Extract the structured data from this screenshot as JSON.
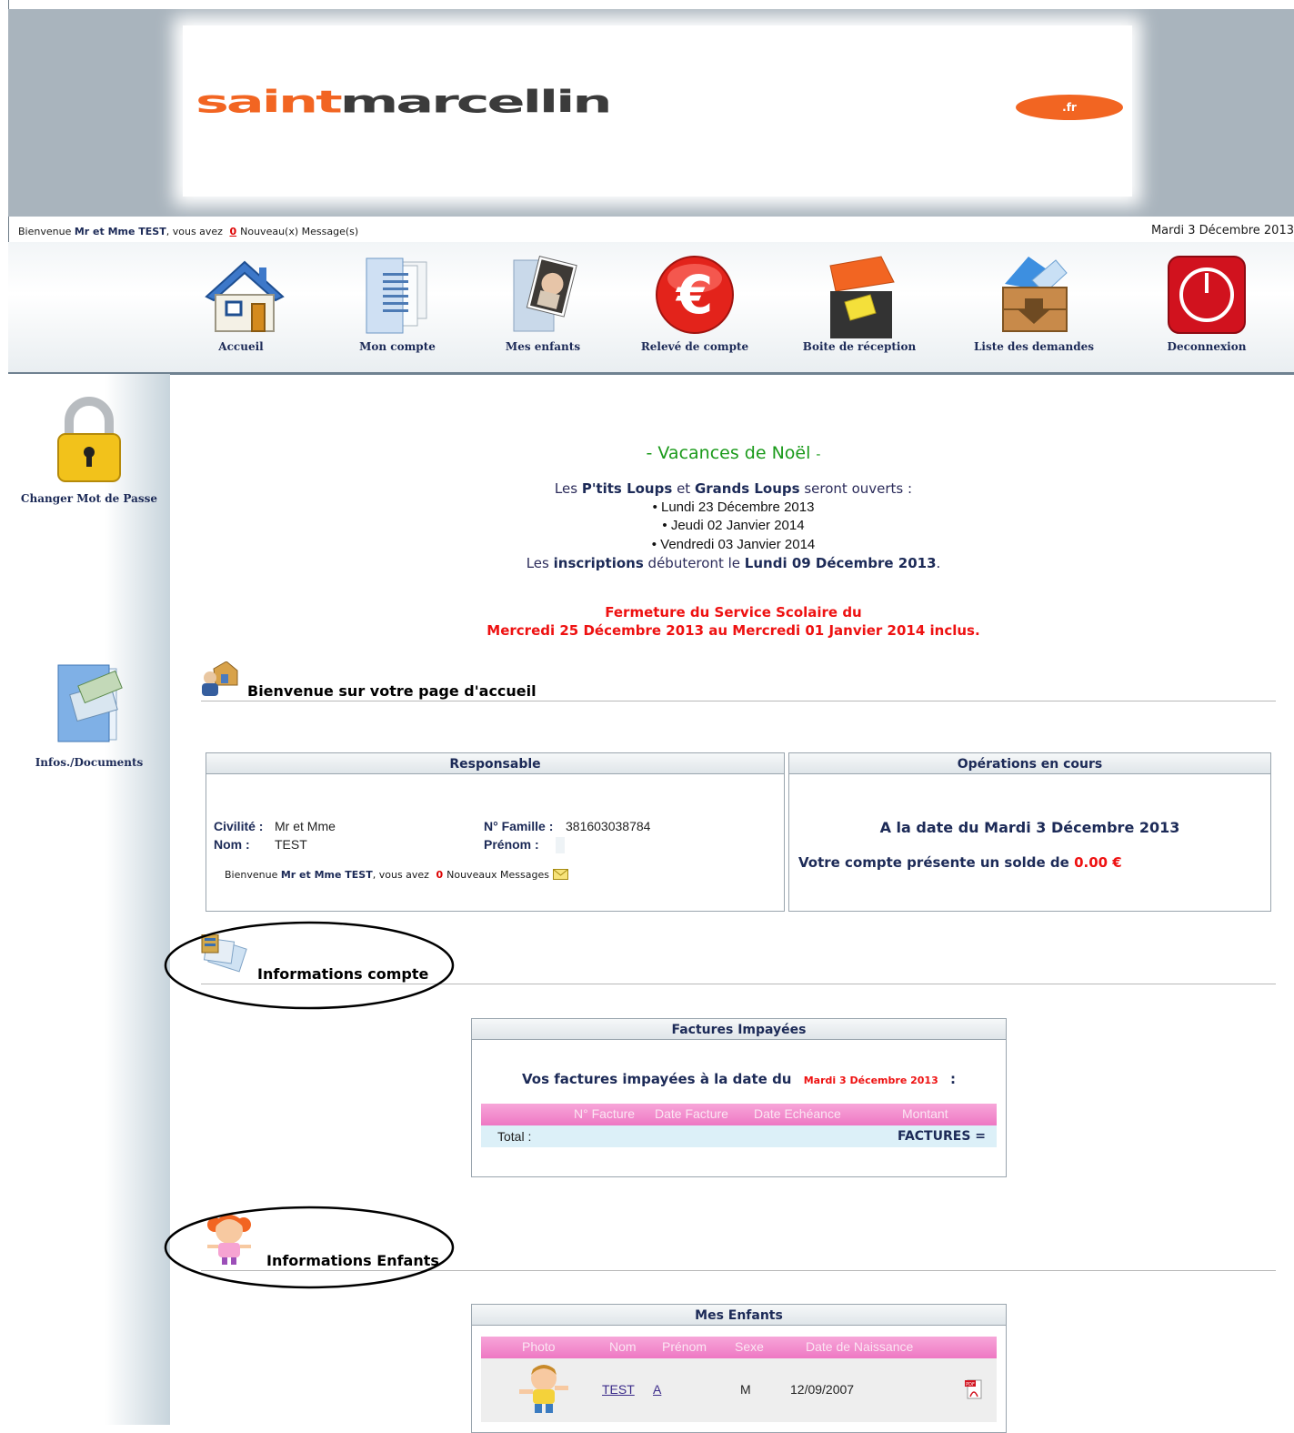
{
  "banner": {
    "logo_part1": "saint",
    "logo_part2": "marcellin",
    "logo_suffix": ".fr"
  },
  "welcome_bar": {
    "prefix": "Bienvenue",
    "name": "Mr et Mme TEST",
    "middle": ", vous avez",
    "count": "0",
    "suffix": "Nouveau(x) Message(s)",
    "date": "Mardi 3 Décembre 2013"
  },
  "nav": {
    "items": [
      {
        "label": "Accueil",
        "icon": "house-icon"
      },
      {
        "label": "Mon compte",
        "icon": "documents-icon"
      },
      {
        "label": "Mes enfants",
        "icon": "baby-photo-icon"
      },
      {
        "label": "Relevé de compte",
        "icon": "euro-icon"
      },
      {
        "label": "Boite de réception",
        "icon": "inbox-icon"
      },
      {
        "label": "Liste des demandes",
        "icon": "box-download-icon"
      },
      {
        "label": "Deconnexion",
        "icon": "power-icon"
      }
    ]
  },
  "sidebar": {
    "items": [
      {
        "label": "Changer Mot de Passe",
        "icon": "padlock-icon"
      },
      {
        "label": "Infos./Documents",
        "icon": "documents-icon"
      }
    ]
  },
  "announcement": {
    "title_dash_left": "-",
    "title": "Vacances de Noël",
    "title_dash_right": "-",
    "intro_pre": "Les",
    "intro_b1": "P'tits Loups",
    "intro_mid": "et",
    "intro_b2": "Grands Loups",
    "intro_post": "seront ouverts :",
    "dates": [
      "Lundi 23 Décembre 2013",
      "Jeudi 02 Janvier 2014",
      "Vendredi 03 Janvier 2014"
    ],
    "insc_pre": "Les",
    "insc_b1": "inscriptions",
    "insc_mid": "débuteront le",
    "insc_b2": "Lundi 09 Décembre 2013",
    "insc_post": ".",
    "closure_line1": "Fermeture du Service Scolaire du",
    "closure_line2": "Mercredi 25 Décembre 2013 au Mercredi 01 Janvier 2014 inclus."
  },
  "welcome_section": {
    "title": "Bienvenue sur votre page d'accueil"
  },
  "responsable": {
    "header": "Responsable",
    "civilite_label": "Civilité :",
    "civilite_value": "Mr et Mme",
    "nom_label": "Nom :",
    "nom_value": "TEST",
    "famille_label": "N° Famille :",
    "famille_value": "381603038784",
    "prenom_label": "Prénom :",
    "prenom_value": "",
    "msg_prefix": "Bienvenue",
    "msg_name": "Mr et Mme TEST",
    "msg_middle": ", vous avez",
    "msg_count": "0",
    "msg_suffix": "Nouveaux Messages"
  },
  "operations": {
    "header": "Opérations en cours",
    "date_line_prefix": "A la date du",
    "date_line_value": "Mardi 3 Décembre 2013",
    "solde_prefix": "Votre compte présente un solde de",
    "solde_value": "0.00 €"
  },
  "info_compte": {
    "title": "Informations compte"
  },
  "factures": {
    "header": "Factures Impayées",
    "line_prefix": "Vos factures impayées à la date du",
    "line_date": "Mardi 3 Décembre 2013",
    "line_suffix": ":",
    "columns": [
      "N° Facture",
      "Date Facture",
      "Date Echéance",
      "Montant"
    ],
    "total_label": "Total :",
    "total_value": "FACTURES ="
  },
  "info_enfants": {
    "title": "Informations Enfants"
  },
  "enfants": {
    "header": "Mes Enfants",
    "columns": [
      "Photo",
      "Nom",
      "Prénom",
      "Sexe",
      "Date de Naissance"
    ],
    "rows": [
      {
        "nom": "TEST",
        "prenom": "A",
        "sexe": "M",
        "naissance": "12/09/2007"
      }
    ]
  },
  "colors": {
    "accent_orange": "#f26522",
    "nav_text": "#1c2a57",
    "alert_red": "#e11111",
    "title_green": "#1a9a1a",
    "table_pink": "#ee77c3"
  }
}
